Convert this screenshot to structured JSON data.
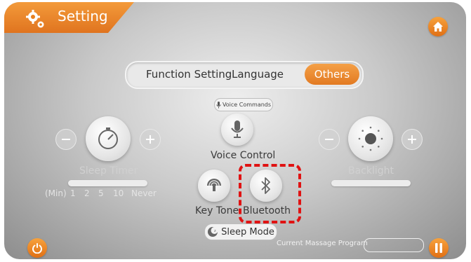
{
  "header": {
    "title": "Setting"
  },
  "tabs": [
    {
      "label": "Function Setting"
    },
    {
      "label": "Language"
    },
    {
      "label": "Others",
      "active": true
    }
  ],
  "voice_commands_label": "Voice Commands",
  "controls": {
    "voice_control_label": "Voice Control",
    "key_tone_label": "Key Tone",
    "bluetooth_label": "Bluetooth",
    "sleep_mode_label": "Sleep Mode"
  },
  "sleep_timer": {
    "label": "Sleep Timer",
    "scale": [
      "(Min)",
      "1",
      "2",
      "5",
      "10",
      "Never"
    ]
  },
  "backlight": {
    "label": "Backlight"
  },
  "footer": {
    "current_program_label": "Current Massage Program",
    "current_program_value": ""
  },
  "colors": {
    "accent": "#e8801f",
    "highlight": "#e01212",
    "panel": "#c9c9c9"
  },
  "icons": [
    "gear-icon",
    "home-icon",
    "power-icon",
    "pause-icon",
    "microphone-icon",
    "timer-icon",
    "sun-icon",
    "speaker-icon",
    "bluetooth-icon",
    "moon-icon",
    "minus-icon",
    "plus-icon"
  ]
}
